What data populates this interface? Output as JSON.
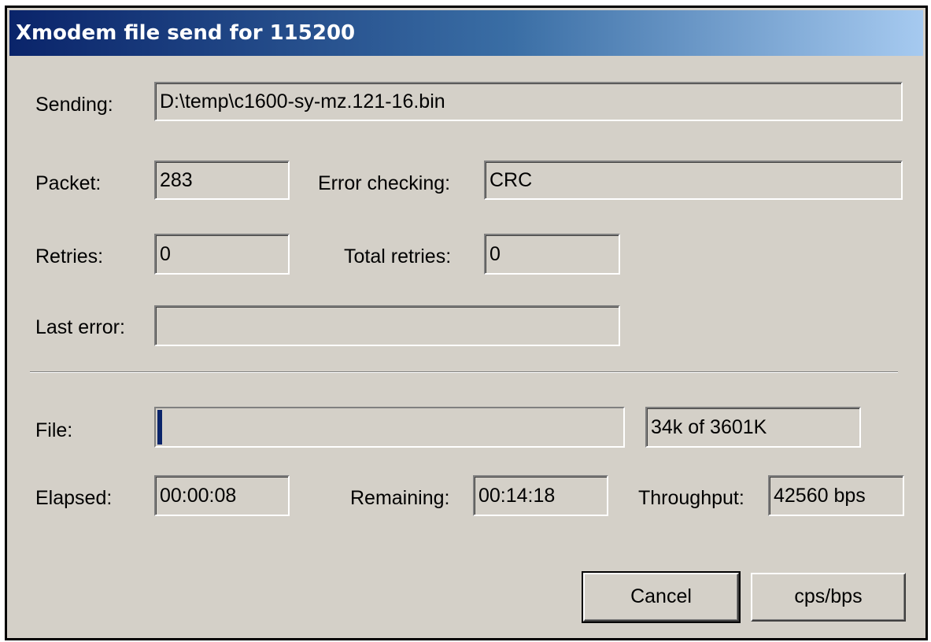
{
  "window": {
    "title": "Xmodem file send for 115200"
  },
  "fields": {
    "sending_label": "Sending:",
    "sending_value": "D:\\temp\\c1600-sy-mz.121-16.bin",
    "packet_label": "Packet:",
    "packet_value": "283",
    "error_checking_label": "Error checking:",
    "error_checking_value": "CRC",
    "retries_label": "Retries:",
    "retries_value": "0",
    "total_retries_label": "Total retries:",
    "total_retries_value": "0",
    "last_error_label": "Last error:",
    "last_error_value": ""
  },
  "progress": {
    "file_label": "File:",
    "file_fraction": 0.0094,
    "size_text": "34k of 3601K",
    "elapsed_label": "Elapsed:",
    "elapsed_value": "00:00:08",
    "remaining_label": "Remaining:",
    "remaining_value": "00:14:18",
    "throughput_label": "Throughput:",
    "throughput_value": "42560 bps"
  },
  "buttons": {
    "cancel_label": "Cancel",
    "cps_bps_label": "cps/bps"
  },
  "colors": {
    "dialog_face": "#d4d0c8",
    "title_gradient_start": "#0a246a",
    "title_gradient_end": "#a6caf0",
    "progress_fill": "#0a246a"
  }
}
